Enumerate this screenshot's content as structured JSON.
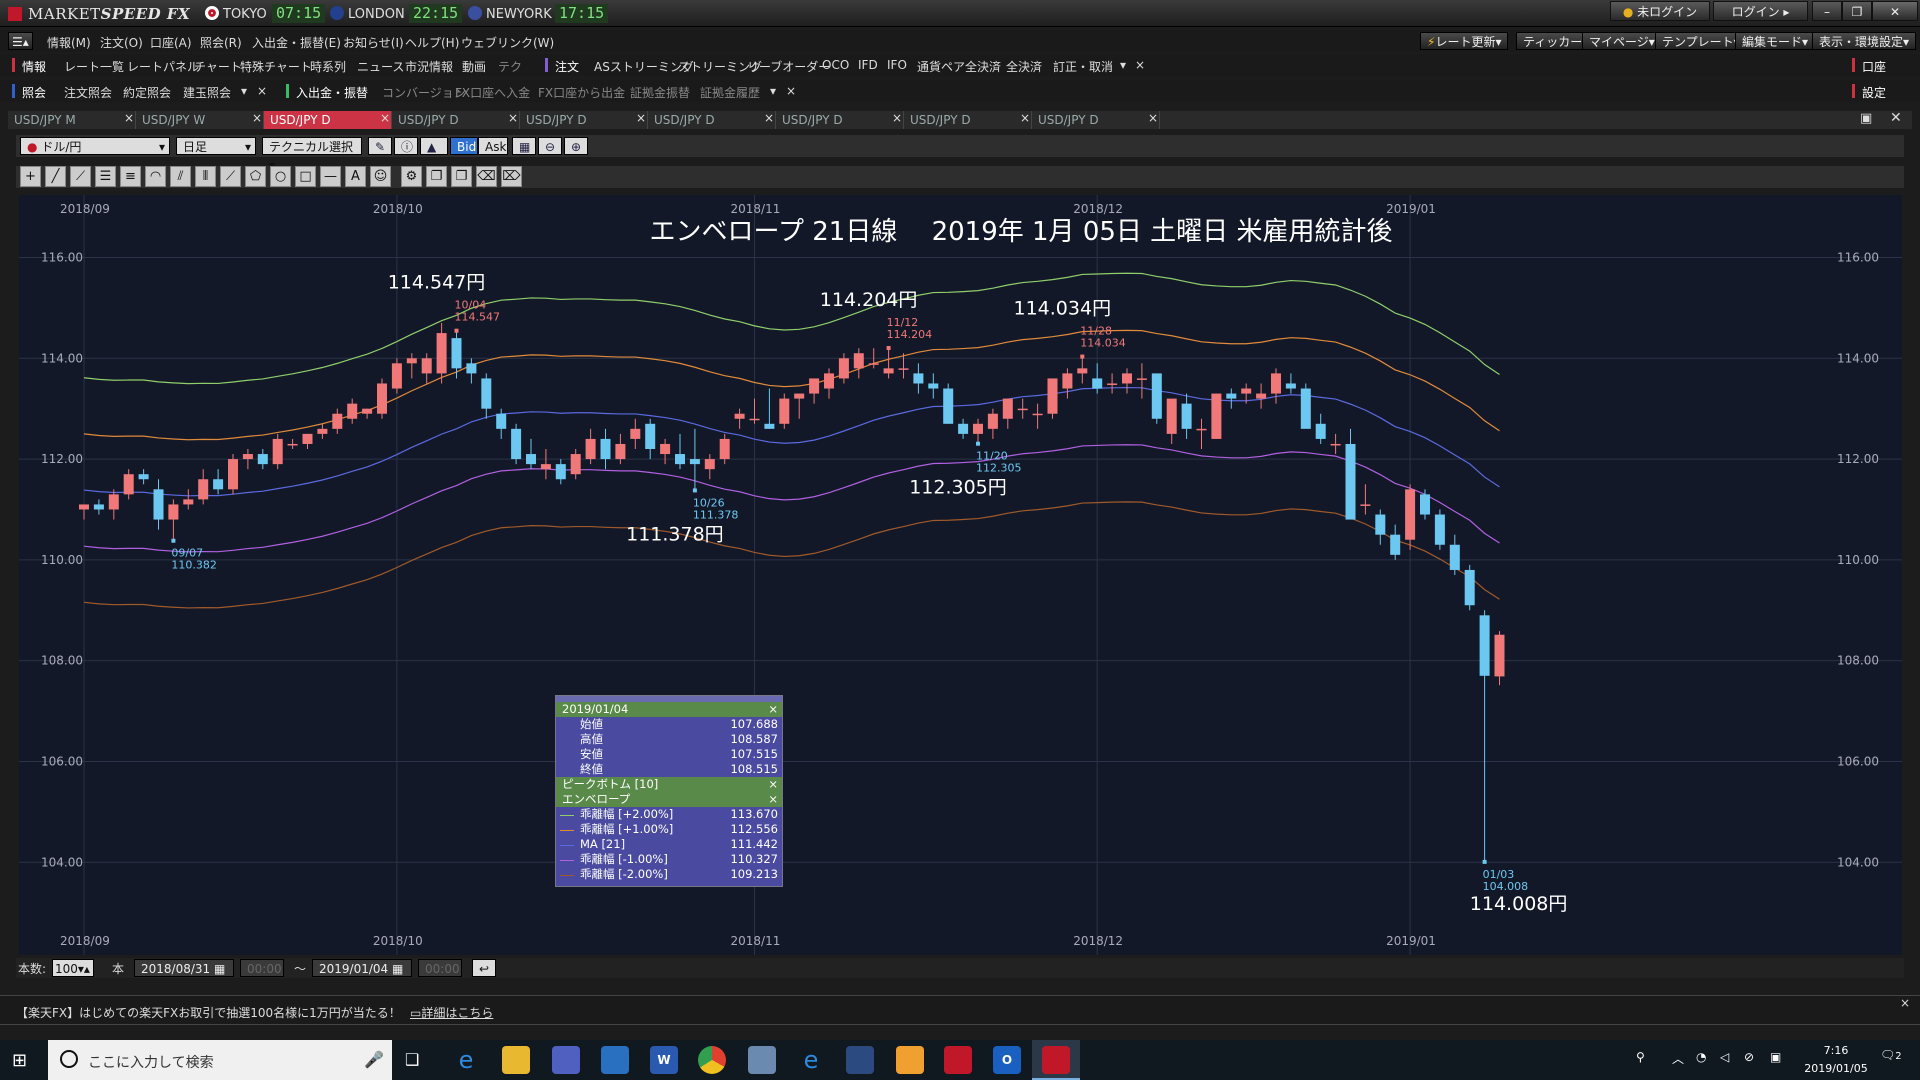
{
  "app": {
    "brand_light": "MARKET",
    "brand_bold": "SPEED FX"
  },
  "clocks": [
    {
      "city": "TOKYO",
      "time": "07:15",
      "flag": "#c0182a"
    },
    {
      "city": "LONDON",
      "time": "22:15",
      "flag": "#23408e"
    },
    {
      "city": "NEWYORK",
      "time": "17:15",
      "flag": "#3a4fa0"
    }
  ],
  "window_buttons": {
    "not_logged_in": "未ログイン",
    "login": "ログイン"
  },
  "menu": [
    "情報(M)",
    "注文(O)",
    "口座(A)",
    "照会(R)",
    "入出金・振替(E)",
    "お知らせ(I)",
    "ヘルプ(H)",
    "ウェブリンク(W)"
  ],
  "right_menu": [
    "レート更新",
    "ティッカー",
    "マイページ",
    "テンプレート",
    "編集モード",
    "表示・環境設定"
  ],
  "toolbar1": [
    "情報",
    "レート一覧",
    "レートパネル",
    "チャート",
    "特殊チャート",
    "時系列",
    "ニュース",
    "市況情報",
    "動画",
    "テク",
    "注文",
    "ASストリーミング",
    "ストリーミング",
    "リーブオーダー",
    "OCO",
    "IFD",
    "IFO",
    "通貨ペア全決済",
    "全決済",
    "訂正・取消"
  ],
  "toolbar1_right": "口座",
  "toolbar2": [
    "照会",
    "注文照会",
    "約定照会",
    "建玉照会",
    "入出金・振替",
    "コンバージョン",
    "FX口座へ入金",
    "FX口座から出金",
    "証拠金振替",
    "証拠金履歴"
  ],
  "toolbar2_right": "設定",
  "tabs": [
    {
      "label": "USD/JPY M",
      "active": false
    },
    {
      "label": "USD/JPY W",
      "active": false
    },
    {
      "label": "USD/JPY D",
      "active": true
    },
    {
      "label": "USD/JPY D",
      "active": false
    },
    {
      "label": "USD/JPY D",
      "active": false
    },
    {
      "label": "USD/JPY D",
      "active": false
    },
    {
      "label": "USD/JPY D",
      "active": false
    },
    {
      "label": "USD/JPY D",
      "active": false
    },
    {
      "label": "USD/JPY D",
      "active": false
    }
  ],
  "controls": {
    "pair": "ドル/円",
    "period": "日足",
    "tech": "テクニカル選択",
    "bid": "Bid",
    "ask": "Ask"
  },
  "bottom": {
    "count_label": "本数:",
    "count": "100",
    "unit": "本",
    "from": "2018/08/31",
    "from_time": "00:00",
    "to": "2019/01/04",
    "to_time": "00:00",
    "tilde": "～"
  },
  "ad": {
    "text": "【楽天FX】はじめての楽天FXお取引で抽選100名様に1万円が当たる！",
    "link": "詳細はこちら"
  },
  "taskbar": {
    "search": "ここに入力して検索",
    "time": "7:16",
    "date": "2019/01/05",
    "notif": "2"
  },
  "ohlc_panel": {
    "date": "2019/01/04",
    "rows": [
      {
        "k": "始値",
        "v": "107.688"
      },
      {
        "k": "高値",
        "v": "108.587"
      },
      {
        "k": "安値",
        "v": "107.515"
      },
      {
        "k": "終値",
        "v": "108.515"
      }
    ],
    "peak_label": "ピークボトム [10]",
    "env_label": "エンベロープ",
    "env_rows": [
      {
        "k": "乖離幅 [+2.00%]",
        "v": "113.670",
        "c": "#8fcf6a"
      },
      {
        "k": "乖離幅 [+1.00%]",
        "v": "112.556",
        "c": "#e08a3a"
      },
      {
        "k": "MA [21]",
        "v": "111.442",
        "c": "#5a6ae0"
      },
      {
        "k": "乖離幅 [-1.00%]",
        "v": "110.327",
        "c": "#b060e0"
      },
      {
        "k": "乖離幅 [-2.00%]",
        "v": "109.213",
        "c": "#a05a2a"
      }
    ]
  },
  "chart_data": {
    "type": "candlestick",
    "title": "エンベロープ 21日線　 2019年 1月 05日 土曜日 米雇用統計後",
    "ylim": [
      102.2,
      117.2
    ],
    "yticks": [
      "116.00",
      "114.00",
      "112.00",
      "110.00",
      "108.00",
      "106.00",
      "104.00"
    ],
    "xticks": [
      {
        "label": "2018/09",
        "i": 0
      },
      {
        "label": "2018/10",
        "i": 21
      },
      {
        "label": "2018/11",
        "i": 45
      },
      {
        "label": "2018/12",
        "i": 68
      },
      {
        "label": "2019/01",
        "i": 89
      }
    ],
    "candles": [
      [
        111.0,
        111.1,
        110.8,
        111.1
      ],
      [
        111.1,
        111.2,
        110.9,
        111.0
      ],
      [
        111.0,
        111.4,
        110.8,
        111.3
      ],
      [
        111.3,
        111.8,
        111.2,
        111.7
      ],
      [
        111.7,
        111.8,
        111.5,
        111.6
      ],
      [
        111.4,
        111.6,
        110.6,
        110.8
      ],
      [
        110.8,
        111.2,
        110.38,
        111.1
      ],
      [
        111.1,
        111.4,
        111.0,
        111.2
      ],
      [
        111.2,
        111.8,
        111.1,
        111.6
      ],
      [
        111.6,
        111.8,
        111.3,
        111.4
      ],
      [
        111.4,
        112.1,
        111.3,
        112.0
      ],
      [
        112.0,
        112.2,
        111.8,
        112.1
      ],
      [
        112.1,
        112.2,
        111.8,
        111.9
      ],
      [
        111.9,
        112.5,
        111.8,
        112.4
      ],
      [
        112.3,
        112.4,
        112.2,
        112.3
      ],
      [
        112.3,
        112.5,
        112.2,
        112.5
      ],
      [
        112.5,
        112.7,
        112.4,
        112.6
      ],
      [
        112.6,
        113.0,
        112.5,
        112.9
      ],
      [
        112.8,
        113.2,
        112.7,
        113.1
      ],
      [
        112.9,
        113.0,
        112.8,
        113.0
      ],
      [
        112.9,
        113.6,
        112.8,
        113.5
      ],
      [
        113.4,
        114.0,
        113.3,
        113.9
      ],
      [
        113.9,
        114.1,
        113.6,
        114.0
      ],
      [
        113.7,
        114.1,
        113.5,
        114.0
      ],
      [
        113.7,
        114.7,
        113.5,
        114.5
      ],
      [
        114.4,
        114.547,
        113.6,
        113.8
      ],
      [
        113.9,
        114.0,
        113.5,
        113.7
      ],
      [
        113.6,
        113.7,
        112.8,
        113.0
      ],
      [
        112.9,
        113.0,
        112.4,
        112.6
      ],
      [
        112.6,
        112.7,
        111.9,
        112.0
      ],
      [
        112.1,
        112.4,
        111.8,
        111.9
      ],
      [
        111.8,
        112.2,
        111.6,
        111.9
      ],
      [
        111.9,
        112.0,
        111.5,
        111.6
      ],
      [
        111.7,
        112.2,
        111.6,
        112.1
      ],
      [
        112.0,
        112.6,
        111.9,
        112.4
      ],
      [
        112.4,
        112.6,
        111.8,
        112.0
      ],
      [
        112.0,
        112.5,
        111.9,
        112.3
      ],
      [
        112.4,
        112.8,
        112.2,
        112.6
      ],
      [
        112.7,
        112.8,
        112.0,
        112.2
      ],
      [
        112.1,
        112.4,
        111.9,
        112.3
      ],
      [
        112.1,
        112.5,
        111.8,
        111.9
      ],
      [
        112.0,
        112.6,
        111.378,
        111.9
      ],
      [
        111.8,
        112.1,
        111.6,
        112.0
      ],
      [
        112.0,
        112.5,
        111.9,
        112.4
      ],
      [
        112.8,
        113.0,
        112.6,
        112.9
      ],
      [
        112.8,
        113.2,
        112.7,
        112.8
      ],
      [
        112.7,
        113.4,
        112.6,
        112.6
      ],
      [
        112.7,
        113.3,
        112.6,
        113.2
      ],
      [
        113.2,
        113.3,
        112.8,
        113.3
      ],
      [
        113.3,
        113.6,
        113.1,
        113.6
      ],
      [
        113.4,
        113.8,
        113.2,
        113.7
      ],
      [
        113.6,
        114.1,
        113.5,
        114.0
      ],
      [
        113.8,
        114.2,
        113.6,
        114.1
      ],
      [
        113.9,
        114.2,
        113.8,
        113.9
      ],
      [
        113.7,
        114.204,
        113.6,
        113.8
      ],
      [
        113.8,
        114.1,
        113.6,
        113.8
      ],
      [
        113.7,
        113.9,
        113.3,
        113.5
      ],
      [
        113.5,
        113.7,
        113.2,
        113.4
      ],
      [
        113.4,
        113.5,
        112.7,
        112.7
      ],
      [
        112.7,
        112.8,
        112.4,
        112.5
      ],
      [
        112.5,
        112.8,
        112.305,
        112.7
      ],
      [
        112.6,
        113.0,
        112.4,
        112.9
      ],
      [
        112.8,
        113.2,
        112.6,
        113.2
      ],
      [
        113.0,
        113.2,
        112.8,
        113.0
      ],
      [
        112.9,
        113.1,
        112.6,
        112.9
      ],
      [
        112.9,
        113.5,
        112.8,
        113.6
      ],
      [
        113.4,
        113.8,
        113.2,
        113.7
      ],
      [
        113.7,
        114.034,
        113.5,
        113.8
      ],
      [
        113.6,
        113.9,
        113.3,
        113.4
      ],
      [
        113.5,
        113.7,
        113.3,
        113.5
      ],
      [
        113.5,
        113.8,
        113.3,
        113.7
      ],
      [
        113.6,
        113.9,
        113.2,
        113.6
      ],
      [
        113.7,
        113.7,
        112.7,
        112.8
      ],
      [
        112.5,
        113.1,
        112.3,
        113.2
      ],
      [
        113.1,
        113.3,
        112.4,
        112.6
      ],
      [
        112.6,
        112.8,
        112.2,
        112.6
      ],
      [
        112.4,
        113.3,
        112.4,
        113.3
      ],
      [
        113.3,
        113.4,
        113.0,
        113.2
      ],
      [
        113.3,
        113.5,
        113.1,
        113.4
      ],
      [
        113.2,
        113.5,
        113.0,
        113.3
      ],
      [
        113.3,
        113.8,
        113.1,
        113.7
      ],
      [
        113.5,
        113.7,
        113.3,
        113.4
      ],
      [
        113.4,
        113.5,
        112.9,
        112.6
      ],
      [
        112.7,
        112.9,
        112.3,
        112.4
      ],
      [
        112.3,
        112.5,
        112.1,
        112.3
      ],
      [
        112.3,
        112.6,
        110.8,
        110.8
      ],
      [
        111.1,
        111.5,
        110.9,
        111.1
      ],
      [
        110.9,
        111.0,
        110.3,
        110.5
      ],
      [
        110.5,
        110.7,
        110.0,
        110.1
      ],
      [
        110.4,
        111.5,
        110.2,
        111.4
      ],
      [
        111.3,
        111.4,
        110.8,
        110.9
      ],
      [
        110.9,
        111.0,
        110.2,
        110.3
      ],
      [
        110.3,
        110.5,
        109.7,
        109.8
      ],
      [
        109.8,
        109.9,
        109.0,
        109.1
      ],
      [
        108.9,
        109.0,
        104.008,
        107.7
      ],
      [
        107.688,
        108.587,
        107.515,
        108.515
      ]
    ],
    "envelope": {
      "plus2": 113.67,
      "plus1": 112.556,
      "ma": 111.442,
      "minus1": 110.327,
      "minus2": 109.213
    },
    "annotations": [
      {
        "i": 6,
        "date": "09/07",
        "price": "110.382",
        "big": "",
        "pos": "low"
      },
      {
        "i": 25,
        "date": "10/04",
        "price": "114.547",
        "big": "114.547円",
        "pos": "high"
      },
      {
        "i": 41,
        "date": "10/26",
        "price": "111.378",
        "big": "111.378円",
        "pos": "low"
      },
      {
        "i": 54,
        "date": "11/12",
        "price": "114.204",
        "big": "114.204円",
        "pos": "high"
      },
      {
        "i": 60,
        "date": "11/20",
        "price": "112.305",
        "big": "112.305円",
        "pos": "low"
      },
      {
        "i": 67,
        "date": "11/28",
        "price": "114.034",
        "big": "114.034円",
        "pos": "high"
      },
      {
        "i": 94,
        "date": "01/03",
        "price": "104.008",
        "big": "114.008円",
        "pos": "low"
      }
    ],
    "colors": {
      "up": "#f07878",
      "down": "#6cc8f0",
      "bg": "#131829",
      "grid": "#2a3248"
    }
  }
}
